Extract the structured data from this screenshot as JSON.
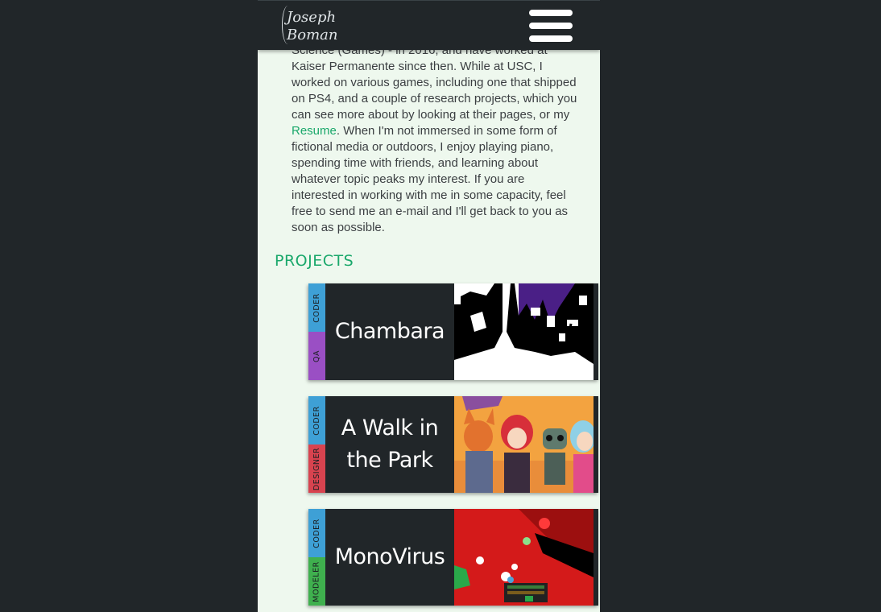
{
  "header": {
    "logo_line1": "Joseph",
    "logo_line2": "Boman",
    "menu_icon": "hamburger-menu-icon"
  },
  "about": {
    "text_before_link": "Science (Games) - in 2016, and have worked at Kaiser Permanente since then. While at USC, I worked on various games, including one that shipped on PS4, and a couple of research projects, which you can see more about by looking at their pages, or my ",
    "resume_link": "Resume",
    "text_after_link": ". When I'm not immersed in some form of fictional media or outdoors, I enjoy playing piano, spending time with friends, and learning about whatever topic peaks my interest. If you are interested in working with me in some capacity, feel free to send me an e-mail and I'll get back to you as soon as possible."
  },
  "projects": {
    "title": "PROJECTS",
    "items": [
      {
        "title": "Chambara",
        "tags": [
          {
            "label": "CODER",
            "color": "#3ea0d6"
          },
          {
            "label": "QA",
            "color": "#9a4fc4"
          }
        ]
      },
      {
        "title": "A Walk in the Park",
        "tags": [
          {
            "label": "CODER",
            "color": "#3ea0d6"
          },
          {
            "label": "DESIGNER",
            "color": "#d8434f"
          }
        ]
      },
      {
        "title": "MonoVirus",
        "tags": [
          {
            "label": "CODER",
            "color": "#3ea0d6"
          },
          {
            "label": "MODELER",
            "color": "#3fb04e"
          }
        ]
      }
    ]
  },
  "colors": {
    "accent": "#1aa86b",
    "background": "#212629",
    "content_bg": "#eef8ee"
  }
}
